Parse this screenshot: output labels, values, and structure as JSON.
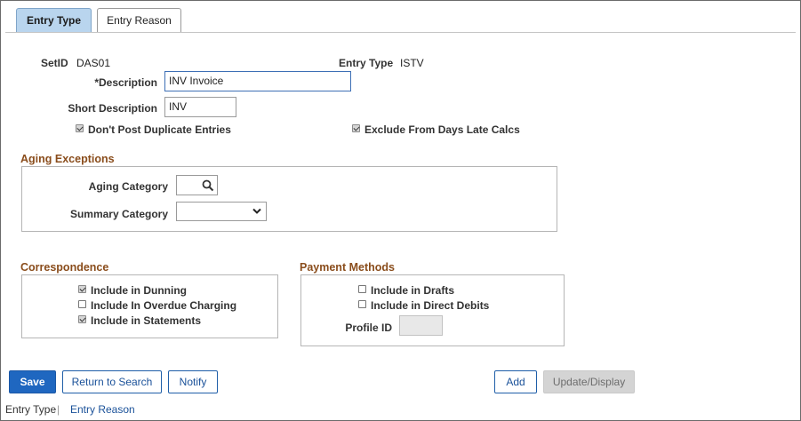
{
  "tabs": [
    {
      "label": "Entry Type",
      "active": true
    },
    {
      "label": "Entry Reason",
      "active": false
    }
  ],
  "fields": {
    "setid_label": "SetID",
    "setid_value": "DAS01",
    "entry_type_label": "Entry Type",
    "entry_type_value": "ISTV",
    "description_label": "*Description",
    "description_value": "INV Invoice",
    "short_description_label": "Short Description",
    "short_description_value": "INV",
    "dont_post_label": "Don't Post Duplicate Entries",
    "dont_post_checked": true,
    "exclude_label": "Exclude From Days Late Calcs",
    "exclude_checked": true
  },
  "aging": {
    "title": "Aging Exceptions",
    "aging_category_label": "Aging Category",
    "aging_category_value": "",
    "summary_category_label": "Summary Category",
    "summary_category_value": ""
  },
  "correspondence": {
    "title": "Correspondence",
    "items": [
      {
        "label": "Include in Dunning",
        "checked": true
      },
      {
        "label": "Include In Overdue Charging",
        "checked": false
      },
      {
        "label": "Include in Statements",
        "checked": true
      }
    ]
  },
  "payment": {
    "title": "Payment Methods",
    "items": [
      {
        "label": "Include in Drafts",
        "checked": false
      },
      {
        "label": "Include in Direct Debits",
        "checked": false
      }
    ],
    "profile_id_label": "Profile ID",
    "profile_id_value": ""
  },
  "buttons": {
    "save": "Save",
    "return_to_search": "Return to Search",
    "notify": "Notify",
    "add": "Add",
    "update_display": "Update/Display"
  },
  "footer": {
    "entry_type": "Entry Type",
    "separator": "|",
    "entry_reason": "Entry Reason"
  },
  "colors": {
    "section_title": "#8a4d1c",
    "active_tab": "#b9d5ee",
    "primary_button": "#1f67c0",
    "link": "#1a5199"
  }
}
